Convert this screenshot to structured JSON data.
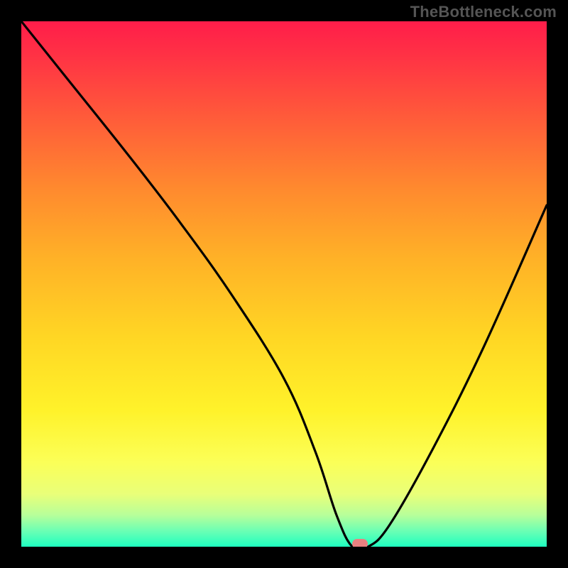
{
  "watermark": "TheBottleneck.com",
  "colors": {
    "frame": "#000000",
    "watermark": "#555555",
    "curve": "#000000",
    "marker": "#e98080"
  },
  "chart_data": {
    "type": "line",
    "title": "",
    "xlabel": "",
    "ylabel": "",
    "xlim": [
      0,
      100
    ],
    "ylim": [
      0,
      100
    ],
    "x": [
      0,
      8,
      20,
      30,
      40,
      50,
      56,
      60,
      63,
      66,
      70,
      78,
      88,
      100
    ],
    "values": [
      100,
      90,
      75,
      62,
      48,
      32,
      18,
      6,
      0,
      0,
      4,
      18,
      38,
      65
    ],
    "marker": {
      "x": 64.5,
      "y": 0
    },
    "background_gradient_stops": [
      {
        "pos": 0,
        "color": "#ff1d4a"
      },
      {
        "pos": 6,
        "color": "#ff3045"
      },
      {
        "pos": 18,
        "color": "#ff5a3a"
      },
      {
        "pos": 32,
        "color": "#ff8a2e"
      },
      {
        "pos": 45,
        "color": "#ffb127"
      },
      {
        "pos": 60,
        "color": "#ffd624"
      },
      {
        "pos": 74,
        "color": "#fff22a"
      },
      {
        "pos": 84,
        "color": "#fbff58"
      },
      {
        "pos": 90,
        "color": "#e9ff79"
      },
      {
        "pos": 94,
        "color": "#b7ff9a"
      },
      {
        "pos": 97,
        "color": "#6bffb4"
      },
      {
        "pos": 100,
        "color": "#1effc0"
      }
    ]
  }
}
